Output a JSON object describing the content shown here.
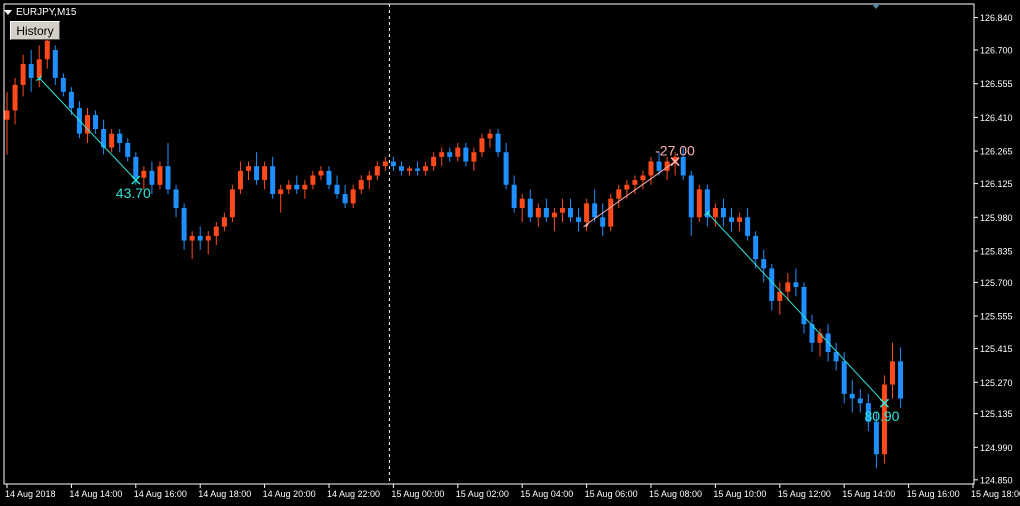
{
  "window": {
    "symbol_title": "EURJPY,M15",
    "history_button": "History"
  },
  "colors": {
    "background": "#000000",
    "bull": "#ff4a1c",
    "bear": "#1e90ff",
    "axis": "#ffffff",
    "trade_win": "#2ee6d6",
    "trade_loss": "#ffb0b0"
  },
  "chart_data": {
    "type": "candlestick",
    "symbol": "EURJPY",
    "timeframe": "M15",
    "ylim": [
      124.845,
      126.855
    ],
    "y_ticks": [
      "126.840",
      "126.700",
      "126.555",
      "126.410",
      "126.265",
      "126.125",
      "125.980",
      "125.835",
      "125.700",
      "125.555",
      "125.415",
      "125.270",
      "125.135",
      "124.990",
      "124.850"
    ],
    "x_ticks": [
      {
        "label": "14 Aug 2018",
        "bar": 0
      },
      {
        "label": "14 Aug 14:00",
        "bar": 8
      },
      {
        "label": "14 Aug 16:00",
        "bar": 16
      },
      {
        "label": "14 Aug 18:00",
        "bar": 24
      },
      {
        "label": "14 Aug 20:00",
        "bar": 32
      },
      {
        "label": "14 Aug 22:00",
        "bar": 40
      },
      {
        "label": "15 Aug 00:00",
        "bar": 48
      },
      {
        "label": "15 Aug 02:00",
        "bar": 56
      },
      {
        "label": "15 Aug 04:00",
        "bar": 64
      },
      {
        "label": "15 Aug 06:00",
        "bar": 72
      },
      {
        "label": "15 Aug 08:00",
        "bar": 80
      },
      {
        "label": "15 Aug 10:00",
        "bar": 88
      },
      {
        "label": "15 Aug 12:00",
        "bar": 96
      },
      {
        "label": "15 Aug 14:00",
        "bar": 104
      },
      {
        "label": "15 Aug 16:00",
        "bar": 112
      },
      {
        "label": "15 Aug 18:00",
        "bar": 120
      }
    ],
    "day_separator_bar": 48,
    "ohlc": [
      [
        126.4,
        126.52,
        126.25,
        126.44
      ],
      [
        126.44,
        126.58,
        126.38,
        126.55
      ],
      [
        126.55,
        126.68,
        126.5,
        126.64
      ],
      [
        126.64,
        126.7,
        126.52,
        126.58
      ],
      [
        126.58,
        126.72,
        126.54,
        126.66
      ],
      [
        126.66,
        126.78,
        126.62,
        126.74
      ],
      [
        126.7,
        126.72,
        126.55,
        126.58
      ],
      [
        126.58,
        126.6,
        126.5,
        126.52
      ],
      [
        126.52,
        126.54,
        126.42,
        126.45
      ],
      [
        126.45,
        126.48,
        126.32,
        126.34
      ],
      [
        126.34,
        126.45,
        126.3,
        126.42
      ],
      [
        126.42,
        126.44,
        126.34,
        126.36
      ],
      [
        126.36,
        126.4,
        126.25,
        126.28
      ],
      [
        126.28,
        126.36,
        126.26,
        126.34
      ],
      [
        126.34,
        126.36,
        126.26,
        126.3
      ],
      [
        126.3,
        126.32,
        126.22,
        126.24
      ],
      [
        126.24,
        126.26,
        126.12,
        126.15
      ],
      [
        126.15,
        126.2,
        126.1,
        126.18
      ],
      [
        126.18,
        126.22,
        126.08,
        126.12
      ],
      [
        126.12,
        126.22,
        126.1,
        126.2
      ],
      [
        126.2,
        126.3,
        126.08,
        126.1
      ],
      [
        126.1,
        126.12,
        125.98,
        126.02
      ],
      [
        126.02,
        126.04,
        125.84,
        125.88
      ],
      [
        125.88,
        125.92,
        125.8,
        125.9
      ],
      [
        125.9,
        125.94,
        125.84,
        125.88
      ],
      [
        125.88,
        125.92,
        125.82,
        125.9
      ],
      [
        125.9,
        125.96,
        125.86,
        125.94
      ],
      [
        125.94,
        126.0,
        125.92,
        125.98
      ],
      [
        125.98,
        126.12,
        125.96,
        126.1
      ],
      [
        126.1,
        126.22,
        126.08,
        126.18
      ],
      [
        126.18,
        126.22,
        126.14,
        126.2
      ],
      [
        126.2,
        126.26,
        126.12,
        126.14
      ],
      [
        126.14,
        126.22,
        126.1,
        126.2
      ],
      [
        126.2,
        126.24,
        126.06,
        126.08
      ],
      [
        126.08,
        126.12,
        126.0,
        126.1
      ],
      [
        126.1,
        126.14,
        126.08,
        126.12
      ],
      [
        126.12,
        126.16,
        126.08,
        126.1
      ],
      [
        126.1,
        126.14,
        126.06,
        126.12
      ],
      [
        126.12,
        126.18,
        126.1,
        126.16
      ],
      [
        126.16,
        126.2,
        126.14,
        126.18
      ],
      [
        126.18,
        126.2,
        126.1,
        126.12
      ],
      [
        126.12,
        126.16,
        126.06,
        126.08
      ],
      [
        126.08,
        126.12,
        126.02,
        126.04
      ],
      [
        126.04,
        126.12,
        126.02,
        126.1
      ],
      [
        126.1,
        126.16,
        126.08,
        126.14
      ],
      [
        126.14,
        126.18,
        126.1,
        126.16
      ],
      [
        126.16,
        126.22,
        126.14,
        126.2
      ],
      [
        126.2,
        126.24,
        126.18,
        126.22
      ],
      [
        126.22,
        126.24,
        126.18,
        126.2
      ],
      [
        126.2,
        126.22,
        126.16,
        126.18
      ],
      [
        126.18,
        126.2,
        126.16,
        126.19
      ],
      [
        126.19,
        126.22,
        126.16,
        126.18
      ],
      [
        126.18,
        126.22,
        126.16,
        126.2
      ],
      [
        126.2,
        126.26,
        126.18,
        126.24
      ],
      [
        126.24,
        126.28,
        126.2,
        126.26
      ],
      [
        126.26,
        126.28,
        126.22,
        126.24
      ],
      [
        126.24,
        126.3,
        126.22,
        126.28
      ],
      [
        126.28,
        126.3,
        126.2,
        126.22
      ],
      [
        126.22,
        126.28,
        126.18,
        126.26
      ],
      [
        126.26,
        126.34,
        126.24,
        126.32
      ],
      [
        126.32,
        126.36,
        126.28,
        126.34
      ],
      [
        126.34,
        126.36,
        126.24,
        126.26
      ],
      [
        126.26,
        126.3,
        126.1,
        126.12
      ],
      [
        126.12,
        126.16,
        126.0,
        126.02
      ],
      [
        126.02,
        126.08,
        125.96,
        126.06
      ],
      [
        126.06,
        126.1,
        125.96,
        125.98
      ],
      [
        125.98,
        126.04,
        125.94,
        126.02
      ],
      [
        126.02,
        126.06,
        125.96,
        125.98
      ],
      [
        125.98,
        126.02,
        125.92,
        126.0
      ],
      [
        126.0,
        126.06,
        125.96,
        126.02
      ],
      [
        126.02,
        126.06,
        125.96,
        125.98
      ],
      [
        125.98,
        126.02,
        125.92,
        125.96
      ],
      [
        125.96,
        126.06,
        125.92,
        126.04
      ],
      [
        126.04,
        126.1,
        125.96,
        125.98
      ],
      [
        125.98,
        126.04,
        125.9,
        125.94
      ],
      [
        125.94,
        126.08,
        125.92,
        126.06
      ],
      [
        126.06,
        126.12,
        126.02,
        126.1
      ],
      [
        126.1,
        126.14,
        126.06,
        126.12
      ],
      [
        126.12,
        126.16,
        126.08,
        126.14
      ],
      [
        126.14,
        126.18,
        126.1,
        126.16
      ],
      [
        126.16,
        126.24,
        126.12,
        126.22
      ],
      [
        126.22,
        126.26,
        126.16,
        126.18
      ],
      [
        126.18,
        126.24,
        126.14,
        126.22
      ],
      [
        126.22,
        126.26,
        126.16,
        126.24
      ],
      [
        126.24,
        126.28,
        126.14,
        126.16
      ],
      [
        126.16,
        126.18,
        125.9,
        125.98
      ],
      [
        125.98,
        126.12,
        125.96,
        126.1
      ],
      [
        126.1,
        126.12,
        125.94,
        125.98
      ],
      [
        125.98,
        126.04,
        125.94,
        126.02
      ],
      [
        126.02,
        126.06,
        125.94,
        125.98
      ],
      [
        125.98,
        126.02,
        125.92,
        125.96
      ],
      [
        125.96,
        126.0,
        125.92,
        125.98
      ],
      [
        125.98,
        126.02,
        125.88,
        125.9
      ],
      [
        125.9,
        125.92,
        125.76,
        125.8
      ],
      [
        125.8,
        125.84,
        125.7,
        125.76
      ],
      [
        125.76,
        125.78,
        125.58,
        125.62
      ],
      [
        125.62,
        125.7,
        125.56,
        125.66
      ],
      [
        125.66,
        125.74,
        125.62,
        125.7
      ],
      [
        125.7,
        125.76,
        125.64,
        125.68
      ],
      [
        125.68,
        125.7,
        125.48,
        125.52
      ],
      [
        125.52,
        125.56,
        125.4,
        125.44
      ],
      [
        125.44,
        125.5,
        125.38,
        125.48
      ],
      [
        125.48,
        125.52,
        125.36,
        125.4
      ],
      [
        125.4,
        125.44,
        125.32,
        125.36
      ],
      [
        125.36,
        125.4,
        125.18,
        125.22
      ],
      [
        125.22,
        125.28,
        125.14,
        125.2
      ],
      [
        125.2,
        125.24,
        125.14,
        125.18
      ],
      [
        125.18,
        125.22,
        125.06,
        125.1
      ],
      [
        125.1,
        125.14,
        124.9,
        124.96
      ],
      [
        124.96,
        125.3,
        124.92,
        125.26
      ],
      [
        125.26,
        125.44,
        125.2,
        125.36
      ],
      [
        125.36,
        125.42,
        125.16,
        125.2
      ]
    ],
    "trades": [
      {
        "open_bar": 4,
        "open_price": 126.58,
        "close_bar": 16,
        "close_price": 126.14,
        "result": "43.70",
        "win": true
      },
      {
        "open_bar": 72,
        "open_price": 125.95,
        "close_bar": 83,
        "close_price": 126.22,
        "result": "-27.00",
        "win": false
      },
      {
        "open_bar": 87,
        "open_price": 126.0,
        "close_bar": 109,
        "close_price": 125.18,
        "result": "80.90",
        "win": true
      }
    ]
  }
}
